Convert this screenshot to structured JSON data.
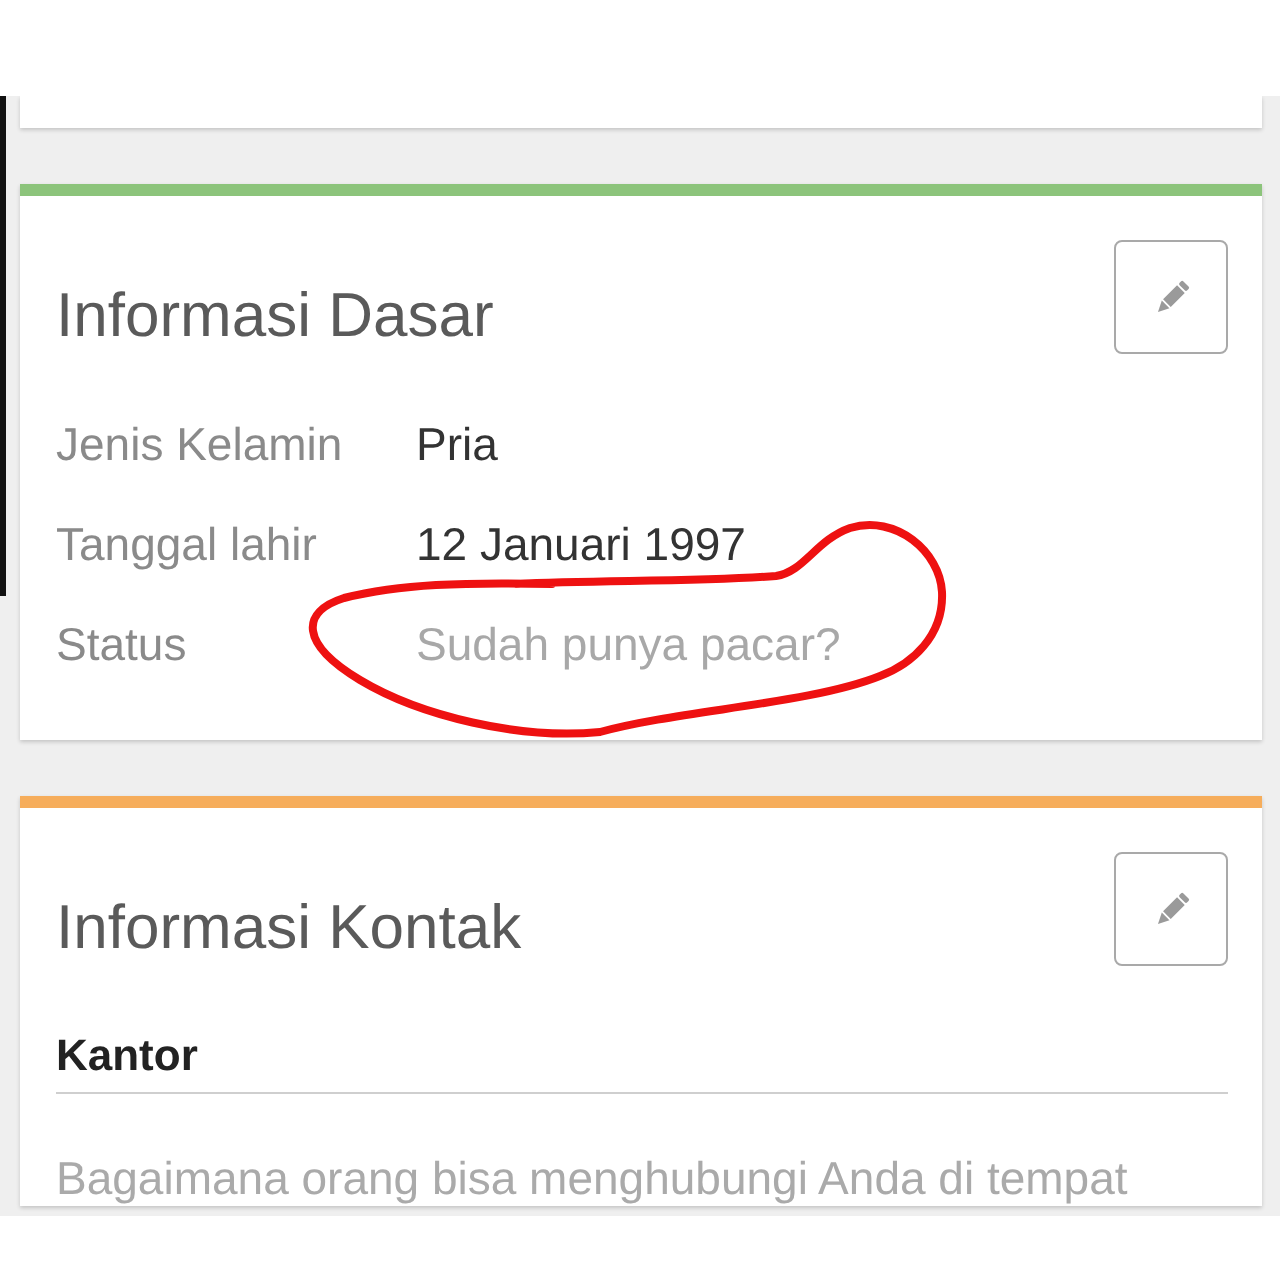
{
  "sections": [
    {
      "title": "Informasi Dasar",
      "color": "#8cc47b",
      "fields": [
        {
          "label": "Jenis Kelamin",
          "value": "Pria",
          "empty": false
        },
        {
          "label": "Tanggal lahir",
          "value": "12 Januari 1997",
          "empty": false
        },
        {
          "label": "Status",
          "value": "Sudah punya pacar?",
          "empty": true
        }
      ]
    },
    {
      "title": "Informasi Kontak",
      "color": "#f6ad5b",
      "subsections": [
        {
          "heading": "Kantor",
          "text": "Bagaimana orang bisa menghubungi Anda di tempat"
        }
      ]
    }
  ]
}
